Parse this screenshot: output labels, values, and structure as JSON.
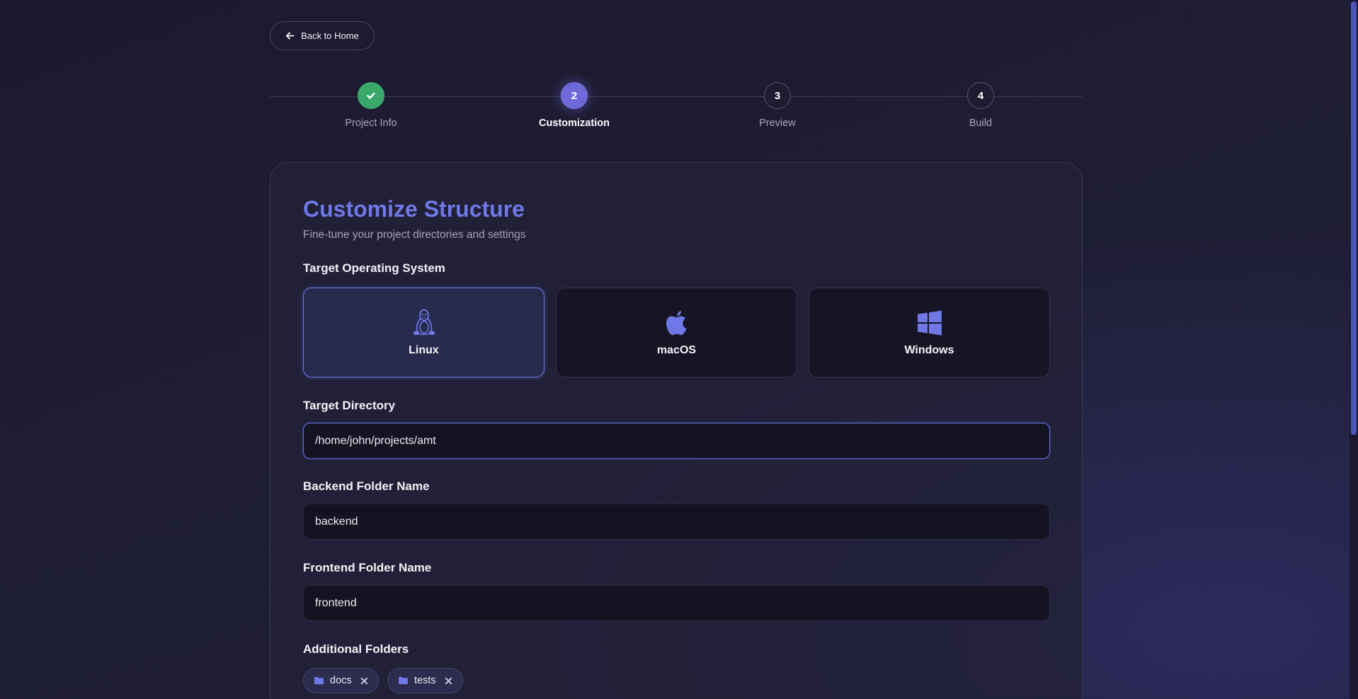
{
  "nav": {
    "back_label": "Back to Home"
  },
  "stepper": {
    "steps": [
      {
        "number": "1",
        "label": "Project Info",
        "state": "done"
      },
      {
        "number": "2",
        "label": "Customization",
        "state": "active"
      },
      {
        "number": "3",
        "label": "Preview",
        "state": "pending"
      },
      {
        "number": "4",
        "label": "Build",
        "state": "pending"
      }
    ]
  },
  "card": {
    "title": "Customize Structure",
    "subtitle": "Fine-tune your project directories and settings"
  },
  "os_section": {
    "label": "Target Operating System",
    "options": [
      {
        "name": "Linux",
        "icon": "linux-icon",
        "selected": true
      },
      {
        "name": "macOS",
        "icon": "apple-icon",
        "selected": false
      },
      {
        "name": "Windows",
        "icon": "windows-icon",
        "selected": false
      }
    ]
  },
  "target_directory": {
    "label": "Target Directory",
    "value": "/home/john/projects/amt"
  },
  "backend_folder": {
    "label": "Backend Folder Name",
    "value": "backend"
  },
  "frontend_folder": {
    "label": "Frontend Folder Name",
    "value": "frontend"
  },
  "additional_folders": {
    "label": "Additional Folders",
    "items": [
      "docs",
      "tests"
    ]
  },
  "colors": {
    "accent": "#6f78e6",
    "success": "#3aa86a",
    "active_step": "#6e68d8"
  }
}
